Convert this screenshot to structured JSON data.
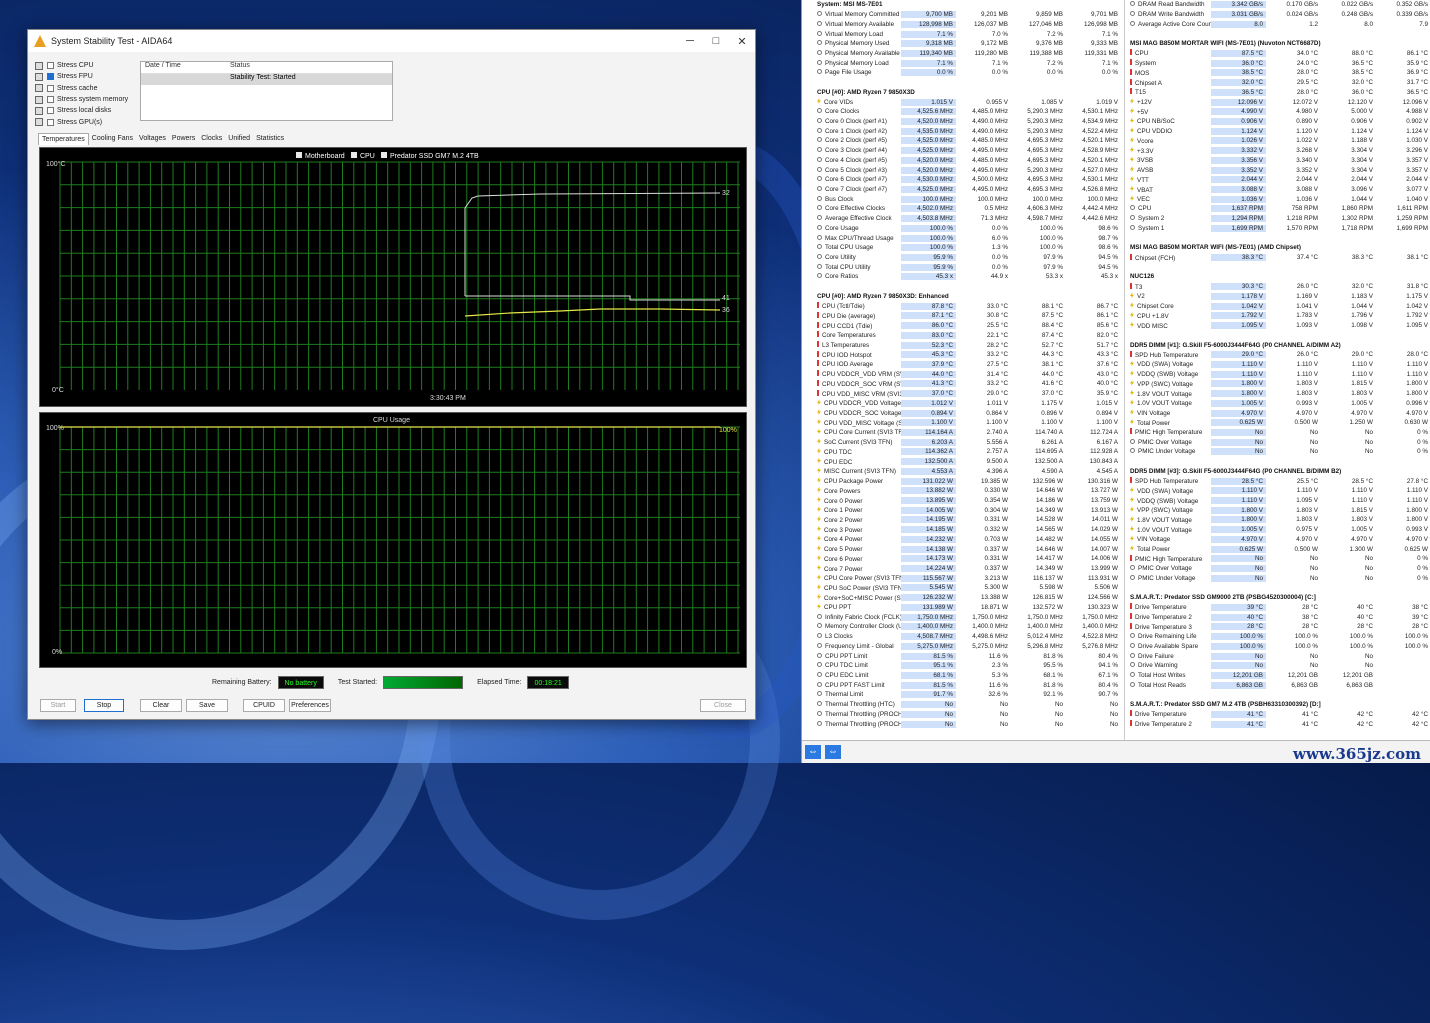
{
  "aida": {
    "title": "System Stability Test - AIDA64",
    "stress": [
      {
        "label": "Stress CPU",
        "on": false
      },
      {
        "label": "Stress FPU",
        "on": true
      },
      {
        "label": "Stress cache",
        "on": false
      },
      {
        "label": "Stress system memory",
        "on": false
      },
      {
        "label": "Stress local disks",
        "on": false
      },
      {
        "label": "Stress GPU(s)",
        "on": false
      }
    ],
    "log_header": [
      "Date / Time",
      "Status"
    ],
    "log_row": [
      "",
      "Stability Test: Started"
    ],
    "tabs": [
      "Temperatures",
      "Cooling Fans",
      "Voltages",
      "Powers",
      "Clocks",
      "Unified",
      "Statistics"
    ],
    "temp_graph": {
      "legend": [
        "Motherboard",
        "CPU",
        "Predator SSD GM7 M.2 4TB"
      ],
      "ymax": "100°C",
      "ymin": "0°C",
      "time": "3:30:43 PM",
      "val1": "41",
      "val2": "36",
      "val3": "32"
    },
    "usage_graph": {
      "title": "CPU Usage",
      "ymax": "100%",
      "ymin": "0%",
      "val": "100%"
    },
    "remaining_battery_label": "Remaining Battery:",
    "remaining_battery": "No battery",
    "test_started_label": "Test Started:",
    "test_started": "",
    "elapsed_label": "Elapsed Time:",
    "elapsed": "00:18:21",
    "buttons": {
      "start": "Start",
      "stop": "Stop",
      "clear": "Clear",
      "save": "Save",
      "cpuid": "CPUID",
      "prefs": "Preferences",
      "close": "Close"
    }
  },
  "hw": {
    "col1": [
      {
        "s": "System: MSI MS-7E01"
      },
      [
        "Virtual Memory Committed",
        "9,700 MB",
        "9,201 MB",
        "9,859 MB",
        "9,701 MB"
      ],
      [
        "Virtual Memory Available",
        "128,998 MB",
        "126,037 MB",
        "127,046 MB",
        "126,998 MB"
      ],
      [
        "Virtual Memory Load",
        "7.1 %",
        "7.0 %",
        "7.2 %",
        "7.1 %"
      ],
      [
        "Physical Memory Used",
        "9,318 MB",
        "9,172 MB",
        "9,376 MB",
        "9,333 MB"
      ],
      [
        "Physical Memory Available",
        "119,340 MB",
        "119,280 MB",
        "119,388 MB",
        "119,331 MB"
      ],
      [
        "Physical Memory Load",
        "7.1 %",
        "7.1 %",
        "7.2 %",
        "7.1 %"
      ],
      [
        "Page File Usage",
        "0.0 %",
        "0.0 %",
        "0.0 %",
        "0.0 %"
      ],
      {
        "b": 1
      },
      {
        "s": "CPU [#0]: AMD Ryzen 7 9850X3D"
      },
      [
        "Core VIDs",
        "1.015 V",
        "0.955 V",
        "1.085 V",
        "1.019 V"
      ],
      [
        "Core Clocks",
        "4,525.6 MHz",
        "4,485.0 MHz",
        "5,290.3 MHz",
        "4,530.1 MHz"
      ],
      [
        "Core 0 Clock (perf #1)",
        "4,520.0 MHz",
        "4,490.0 MHz",
        "5,290.3 MHz",
        "4,534.9 MHz"
      ],
      [
        "Core 1 Clock (perf #2)",
        "4,535.0 MHz",
        "4,490.0 MHz",
        "5,290.3 MHz",
        "4,522.4 MHz"
      ],
      [
        "Core 2 Clock (perf #5)",
        "4,525.0 MHz",
        "4,485.0 MHz",
        "4,695.3 MHz",
        "4,520.1 MHz"
      ],
      [
        "Core 3 Clock (perf #4)",
        "4,525.0 MHz",
        "4,495.0 MHz",
        "4,695.3 MHz",
        "4,528.9 MHz"
      ],
      [
        "Core 4 Clock (perf #5)",
        "4,520.0 MHz",
        "4,485.0 MHz",
        "4,695.3 MHz",
        "4,520.1 MHz"
      ],
      [
        "Core 5 Clock (perf #3)",
        "4,520.0 MHz",
        "4,495.0 MHz",
        "5,290.3 MHz",
        "4,527.0 MHz"
      ],
      [
        "Core 6 Clock (perf #7)",
        "4,530.0 MHz",
        "4,500.0 MHz",
        "4,695.3 MHz",
        "4,530.1 MHz"
      ],
      [
        "Core 7 Clock (perf #7)",
        "4,525.0 MHz",
        "4,495.0 MHz",
        "4,695.3 MHz",
        "4,526.8 MHz"
      ],
      [
        "Bus Clock",
        "100.0 MHz",
        "100.0 MHz",
        "100.0 MHz",
        "100.0 MHz"
      ],
      [
        "Core Effective Clocks",
        "4,502.0 MHz",
        "0.5 MHz",
        "4,606.3 MHz",
        "4,442.4 MHz"
      ],
      [
        "Average Effective Clock",
        "4,503.8 MHz",
        "71.3 MHz",
        "4,598.7 MHz",
        "4,442.6 MHz"
      ],
      [
        "Core Usage",
        "100.0 %",
        "0.0 %",
        "100.0 %",
        "98.6 %"
      ],
      [
        "Max CPU/Thread Usage",
        "100.0 %",
        "6.0 %",
        "100.0 %",
        "98.7 %"
      ],
      [
        "Total CPU Usage",
        "100.0 %",
        "1.3 %",
        "100.0 %",
        "98.6 %"
      ],
      [
        "Core Utility",
        "95.9 %",
        "0.0 %",
        "97.9 %",
        "94.5 %"
      ],
      [
        "Total CPU Utility",
        "95.9 %",
        "0.0 %",
        "97.9 %",
        "94.5 %"
      ],
      [
        "Core Ratios",
        "45.3 x",
        "44.9 x",
        "53.3 x",
        "45.3 x"
      ],
      {
        "b": 1
      },
      {
        "s": "CPU [#0]: AMD Ryzen 7 9850X3D: Enhanced"
      },
      [
        "CPU (Tctl/Tdie)",
        "87.8 °C",
        "33.0 °C",
        "88.1 °C",
        "86.7 °C"
      ],
      [
        "CPU Die (average)",
        "87.1 °C",
        "30.8 °C",
        "87.5 °C",
        "86.1 °C"
      ],
      [
        "CPU CCD1 (Tdie)",
        "86.0 °C",
        "25.5 °C",
        "88.4 °C",
        "85.6 °C"
      ],
      [
        "Core Temperatures",
        "83.0 °C",
        "22.1 °C",
        "87.4 °C",
        "82.0 °C"
      ],
      [
        "L3 Temperatures",
        "52.3 °C",
        "28.2 °C",
        "52.7 °C",
        "51.7 °C"
      ],
      [
        "CPU IOD Hotspot",
        "45.3 °C",
        "33.2 °C",
        "44.3 °C",
        "43.3 °C"
      ],
      [
        "CPU IOD Average",
        "37.9 °C",
        "27.5 °C",
        "38.1 °C",
        "37.6 °C"
      ],
      [
        "CPU VDDCR_VDD VRM (SVI3 TFN)",
        "44.0 °C",
        "31.4 °C",
        "44.0 °C",
        "43.0 °C"
      ],
      [
        "CPU VDDCR_SOC VRM (SVI3 TFN)",
        "41.3 °C",
        "33.2 °C",
        "41.6 °C",
        "40.0 °C"
      ],
      [
        "CPU VDD_MISC VRM (SVI3 TFN)",
        "37.0 °C",
        "29.0 °C",
        "37.0 °C",
        "35.9 °C"
      ],
      [
        "CPU VDDCR_VDD Voltage (SVI3 TFN)",
        "1.012 V",
        "1.011 V",
        "1.175 V",
        "1.015 V"
      ],
      [
        "CPU VDDCR_SOC Voltage (SVI3 TFN)",
        "0.894 V",
        "0.864 V",
        "0.896 V",
        "0.894 V"
      ],
      [
        "CPU VDD_MISC Voltage (SVI3 TFN)",
        "1.100 V",
        "1.100 V",
        "1.100 V",
        "1.100 V"
      ],
      [
        "CPU Core Current (SVI3 TFN)",
        "114.164 A",
        "2.740 A",
        "114.740 A",
        "112.724 A"
      ],
      [
        "SoC Current (SVI3 TFN)",
        "6.203 A",
        "5.556 A",
        "6.261 A",
        "6.167 A"
      ],
      [
        "CPU TDC",
        "114.362 A",
        "2.757 A",
        "114.695 A",
        "112.928 A"
      ],
      [
        "CPU EDC",
        "132.500 A",
        "9.500 A",
        "132.500 A",
        "130.843 A"
      ],
      [
        "MISC Current (SVI3 TFN)",
        "4.553 A",
        "4.396 A",
        "4.590 A",
        "4.545 A"
      ],
      [
        "CPU Package Power",
        "131.022 W",
        "19.385 W",
        "132.596 W",
        "130.316 W"
      ],
      [
        "Core Powers",
        "13.882 W",
        "0.330 W",
        "14.646 W",
        "13.727 W"
      ],
      [
        "Core 0 Power",
        "13.895 W",
        "0.354 W",
        "14.186 W",
        "13.759 W"
      ],
      [
        "Core 1 Power",
        "14.005 W",
        "0.304 W",
        "14.349 W",
        "13.913 W"
      ],
      [
        "Core 2 Power",
        "14.195 W",
        "0.331 W",
        "14.528 W",
        "14.011 W"
      ],
      [
        "Core 3 Power",
        "14.185 W",
        "0.332 W",
        "14.565 W",
        "14.029 W"
      ],
      [
        "Core 4 Power",
        "14.232 W",
        "0.703 W",
        "14.482 W",
        "14.055 W"
      ],
      [
        "Core 5 Power",
        "14.138 W",
        "0.337 W",
        "14.646 W",
        "14.007 W"
      ],
      [
        "Core 6 Power",
        "14.173 W",
        "0.331 W",
        "14.417 W",
        "14.006 W"
      ],
      [
        "Core 7 Power",
        "14.224 W",
        "0.337 W",
        "14.349 W",
        "13.999 W"
      ],
      [
        "CPU Core Power (SVI3 TFN)",
        "115.567 W",
        "3.213 W",
        "116.137 W",
        "113.931 W"
      ],
      [
        "CPU SoC Power (SVI3 TFN)",
        "5.545 W",
        "5.300 W",
        "5.598 W",
        "5.506 W"
      ],
      [
        "Core+SoC+MISC Power (SVI3 TFN)",
        "126.232 W",
        "13.388 W",
        "126.815 W",
        "124.566 W"
      ],
      [
        "CPU PPT",
        "131.989 W",
        "18.871 W",
        "132.572 W",
        "130.323 W"
      ],
      [
        "Infinity Fabric Clock (FCLK)",
        "1,750.0 MHz",
        "1,750.0 MHz",
        "1,750.0 MHz",
        "1,750.0 MHz"
      ],
      [
        "Memory Controller Clock (UCLK)",
        "1,400.0 MHz",
        "1,400.0 MHz",
        "1,400.0 MHz",
        "1,400.0 MHz"
      ],
      [
        "L3 Clocks",
        "4,508.7 MHz",
        "4,498.6 MHz",
        "5,012.4 MHz",
        "4,522.8 MHz"
      ],
      [
        "Frequency Limit - Global",
        "5,275.0 MHz",
        "5,275.0 MHz",
        "5,296.8 MHz",
        "5,276.8 MHz"
      ],
      [
        "CPU PPT Limit",
        "81.5 %",
        "11.6 %",
        "81.8 %",
        "80.4 %"
      ],
      [
        "CPU TDC Limit",
        "95.1 %",
        "2.3 %",
        "95.5 %",
        "94.1 %"
      ],
      [
        "CPU EDC Limit",
        "68.1 %",
        "5.3 %",
        "68.1 %",
        "67.1 %"
      ],
      [
        "CPU PPT FAST Limit",
        "81.5 %",
        "11.6 %",
        "81.8 %",
        "80.4 %"
      ],
      [
        "Thermal Limit",
        "91.7 %",
        "32.6 %",
        "92.1 %",
        "90.7 %"
      ],
      [
        "Thermal Throttling (HTC)",
        "No",
        "No",
        "No",
        "No"
      ],
      [
        "Thermal Throttling (PROCHOT CPU)",
        "No",
        "No",
        "No",
        "No"
      ],
      [
        "Thermal Throttling (PROCHOT EXT)",
        "No",
        "No",
        "No",
        "No"
      ]
    ],
    "col2": [
      [
        "DRAM Read Bandwidth",
        "3.342 GB/s",
        "0.170 GB/s",
        "0.022 GB/s",
        "0.352 GB/s"
      ],
      [
        "DRAM Write Bandwidth",
        "3.031 GB/s",
        "0.024 GB/s",
        "0.248 GB/s",
        "0.339 GB/s"
      ],
      [
        "Average Active Core Count",
        "8.0",
        "1.2",
        "8.0",
        "7.9"
      ],
      {
        "b": 1
      },
      {
        "s": "MSI MAG B850M MORTAR WIFI (MS-7E01) (Nuvoton NCT6687D)"
      },
      [
        "CPU",
        "87.5 °C",
        "34.0 °C",
        "88.0 °C",
        "86.1 °C"
      ],
      [
        "System",
        "36.0 °C",
        "24.0 °C",
        "36.5 °C",
        "35.9 °C"
      ],
      [
        "MOS",
        "38.5 °C",
        "28.0 °C",
        "38.5 °C",
        "36.9 °C"
      ],
      [
        "Chipset A",
        "32.0 °C",
        "29.5 °C",
        "32.0 °C",
        "31.7 °C"
      ],
      [
        "T15",
        "36.5 °C",
        "28.0 °C",
        "36.0 °C",
        "36.5 °C"
      ],
      [
        "+12V",
        "12.096 V",
        "12.072 V",
        "12.120 V",
        "12.096 V"
      ],
      [
        "+5V",
        "4.990 V",
        "4.980 V",
        "5.000 V",
        "4.988 V"
      ],
      [
        "CPU NB/SoC",
        "0.906 V",
        "0.890 V",
        "0.906 V",
        "0.902 V"
      ],
      [
        "CPU VDDIO",
        "1.124 V",
        "1.120 V",
        "1.124 V",
        "1.124 V"
      ],
      [
        "Vcore",
        "1.026 V",
        "1.022 V",
        "1.188 V",
        "1.030 V"
      ],
      [
        "+3.3V",
        "3.332 V",
        "3.268 V",
        "3.304 V",
        "3.296 V"
      ],
      [
        "3VSB",
        "3.356 V",
        "3.340 V",
        "3.304 V",
        "3.357 V"
      ],
      [
        "AVSB",
        "3.352 V",
        "3.352 V",
        "3.304 V",
        "3.357 V"
      ],
      [
        "VTT",
        "2.044 V",
        "2.044 V",
        "2.044 V",
        "2.044 V"
      ],
      [
        "VBAT",
        "3.088 V",
        "3.088 V",
        "3.096 V",
        "3.077 V"
      ],
      [
        "VEC",
        "1.036 V",
        "1.036 V",
        "1.044 V",
        "1.040 V"
      ],
      [
        "CPU",
        "1,637 RPM",
        "758 RPM",
        "1,860 RPM",
        "1,611 RPM"
      ],
      [
        "System 2",
        "1,294 RPM",
        "1,218 RPM",
        "1,302 RPM",
        "1,259 RPM"
      ],
      [
        "System 1",
        "1,699 RPM",
        "1,570 RPM",
        "1,718 RPM",
        "1,699 RPM"
      ],
      {
        "b": 1
      },
      {
        "s": "MSI MAG B850M MORTAR WIFI (MS-7E01) (AMD Chipset)"
      },
      [
        "Chipset (FCH)",
        "38.3 °C",
        "37.4 °C",
        "38.3 °C",
        "38.1 °C"
      ],
      {
        "b": 1
      },
      {
        "s": "NUC126"
      },
      [
        "T3",
        "30.3 °C",
        "26.0 °C",
        "32.0 °C",
        "31.8 °C"
      ],
      [
        "V2",
        "1.178 V",
        "1.169 V",
        "1.183 V",
        "1.175 V"
      ],
      [
        "Chipset Core",
        "1.042 V",
        "1.041 V",
        "1.044 V",
        "1.042 V"
      ],
      [
        "CPU +1.8V",
        "1.792 V",
        "1.783 V",
        "1.796 V",
        "1.792 V"
      ],
      [
        "VDD MISC",
        "1.095 V",
        "1.093 V",
        "1.098 V",
        "1.095 V"
      ],
      {
        "b": 1
      },
      {
        "s": "DDR5 DIMM [#1]: G.Skill F5-6000J3444F64G (P0 CHANNEL A/DIMM A2)"
      },
      [
        "SPD Hub Temperature",
        "29.0 °C",
        "26.0 °C",
        "29.0 °C",
        "28.0 °C"
      ],
      [
        "VDD (SWA) Voltage",
        "1.110 V",
        "1.110 V",
        "1.110 V",
        "1.110 V"
      ],
      [
        "VDDQ (SWB) Voltage",
        "1.110 V",
        "1.110 V",
        "1.110 V",
        "1.110 V"
      ],
      [
        "VPP (SWC) Voltage",
        "1.800 V",
        "1.803 V",
        "1.815 V",
        "1.800 V"
      ],
      [
        "1.8V VOUT Voltage",
        "1.800 V",
        "1.803 V",
        "1.803 V",
        "1.800 V"
      ],
      [
        "1.0V VOUT Voltage",
        "1.005 V",
        "0.993 V",
        "1.005 V",
        "0.996 V"
      ],
      [
        "VIN Voltage",
        "4.970 V",
        "4.970 V",
        "4.970 V",
        "4.970 V"
      ],
      [
        "Total Power",
        "0.625 W",
        "0.500 W",
        "1.250 W",
        "0.630 W"
      ],
      [
        "PMIC High Temperature",
        "No",
        "No",
        "No",
        "0 %"
      ],
      [
        "PMIC Over Voltage",
        "No",
        "No",
        "No",
        "0 %"
      ],
      [
        "PMIC Under Voltage",
        "No",
        "No",
        "No",
        "0 %"
      ],
      {
        "b": 1
      },
      {
        "s": "DDR5 DIMM [#3]: G.Skill F5-6000J3444F64G (P0 CHANNEL B/DIMM B2)"
      },
      [
        "SPD Hub Temperature",
        "28.5 °C",
        "25.5 °C",
        "28.5 °C",
        "27.8 °C"
      ],
      [
        "VDD (SWA) Voltage",
        "1.110 V",
        "1.110 V",
        "1.110 V",
        "1.110 V"
      ],
      [
        "VDDQ (SWB) Voltage",
        "1.110 V",
        "1.095 V",
        "1.110 V",
        "1.110 V"
      ],
      [
        "VPP (SWC) Voltage",
        "1.800 V",
        "1.803 V",
        "1.815 V",
        "1.800 V"
      ],
      [
        "1.8V VOUT Voltage",
        "1.800 V",
        "1.803 V",
        "1.803 V",
        "1.800 V"
      ],
      [
        "1.0V VOUT Voltage",
        "1.005 V",
        "0.975 V",
        "1.005 V",
        "0.993 V"
      ],
      [
        "VIN Voltage",
        "4.970 V",
        "4.970 V",
        "4.970 V",
        "4.970 V"
      ],
      [
        "Total Power",
        "0.625 W",
        "0.500 W",
        "1.300 W",
        "0.625 W"
      ],
      [
        "PMIC High Temperature",
        "No",
        "No",
        "No",
        "0 %"
      ],
      [
        "PMIC Over Voltage",
        "No",
        "No",
        "No",
        "0 %"
      ],
      [
        "PMIC Under Voltage",
        "No",
        "No",
        "No",
        "0 %"
      ],
      {
        "b": 1
      },
      {
        "s": "S.M.A.R.T.: Predator SSD GM9000 2TB (PSBG4520300004) [C:]"
      },
      [
        "Drive Temperature",
        "39 °C",
        "28 °C",
        "40 °C",
        "38 °C"
      ],
      [
        "Drive Temperature 2",
        "40 °C",
        "38 °C",
        "40 °C",
        "39 °C"
      ],
      [
        "Drive Temperature 3",
        "28 °C",
        "28 °C",
        "28 °C",
        "28 °C"
      ],
      [
        "Drive Remaining Life",
        "100.0 %",
        "100.0 %",
        "100.0 %",
        "100.0 %"
      ],
      [
        "Drive Available Spare",
        "100.0 %",
        "100.0 %",
        "100.0 %",
        "100.0 %"
      ],
      [
        "Drive Failure",
        "No",
        "No",
        "No",
        ""
      ],
      [
        "Drive Warning",
        "No",
        "No",
        "No",
        ""
      ],
      [
        "Total Host Writes",
        "12,201 GB",
        "12,201 GB",
        "12,201 GB",
        ""
      ],
      [
        "Total Host Reads",
        "6,863 GB",
        "6,863 GB",
        "6,863 GB",
        ""
      ],
      {
        "b": 1
      },
      {
        "s": "S.M.A.R.T.: Predator SSD GM7 M.2 4TB (PSBH63310300392) [D:]"
      },
      [
        "Drive Temperature",
        "41 °C",
        "41 °C",
        "42 °C",
        "42 °C"
      ],
      [
        "Drive Temperature 2",
        "41 °C",
        "41 °C",
        "42 °C",
        "42 °C"
      ]
    ],
    "watermark": "www.365jz.com"
  }
}
